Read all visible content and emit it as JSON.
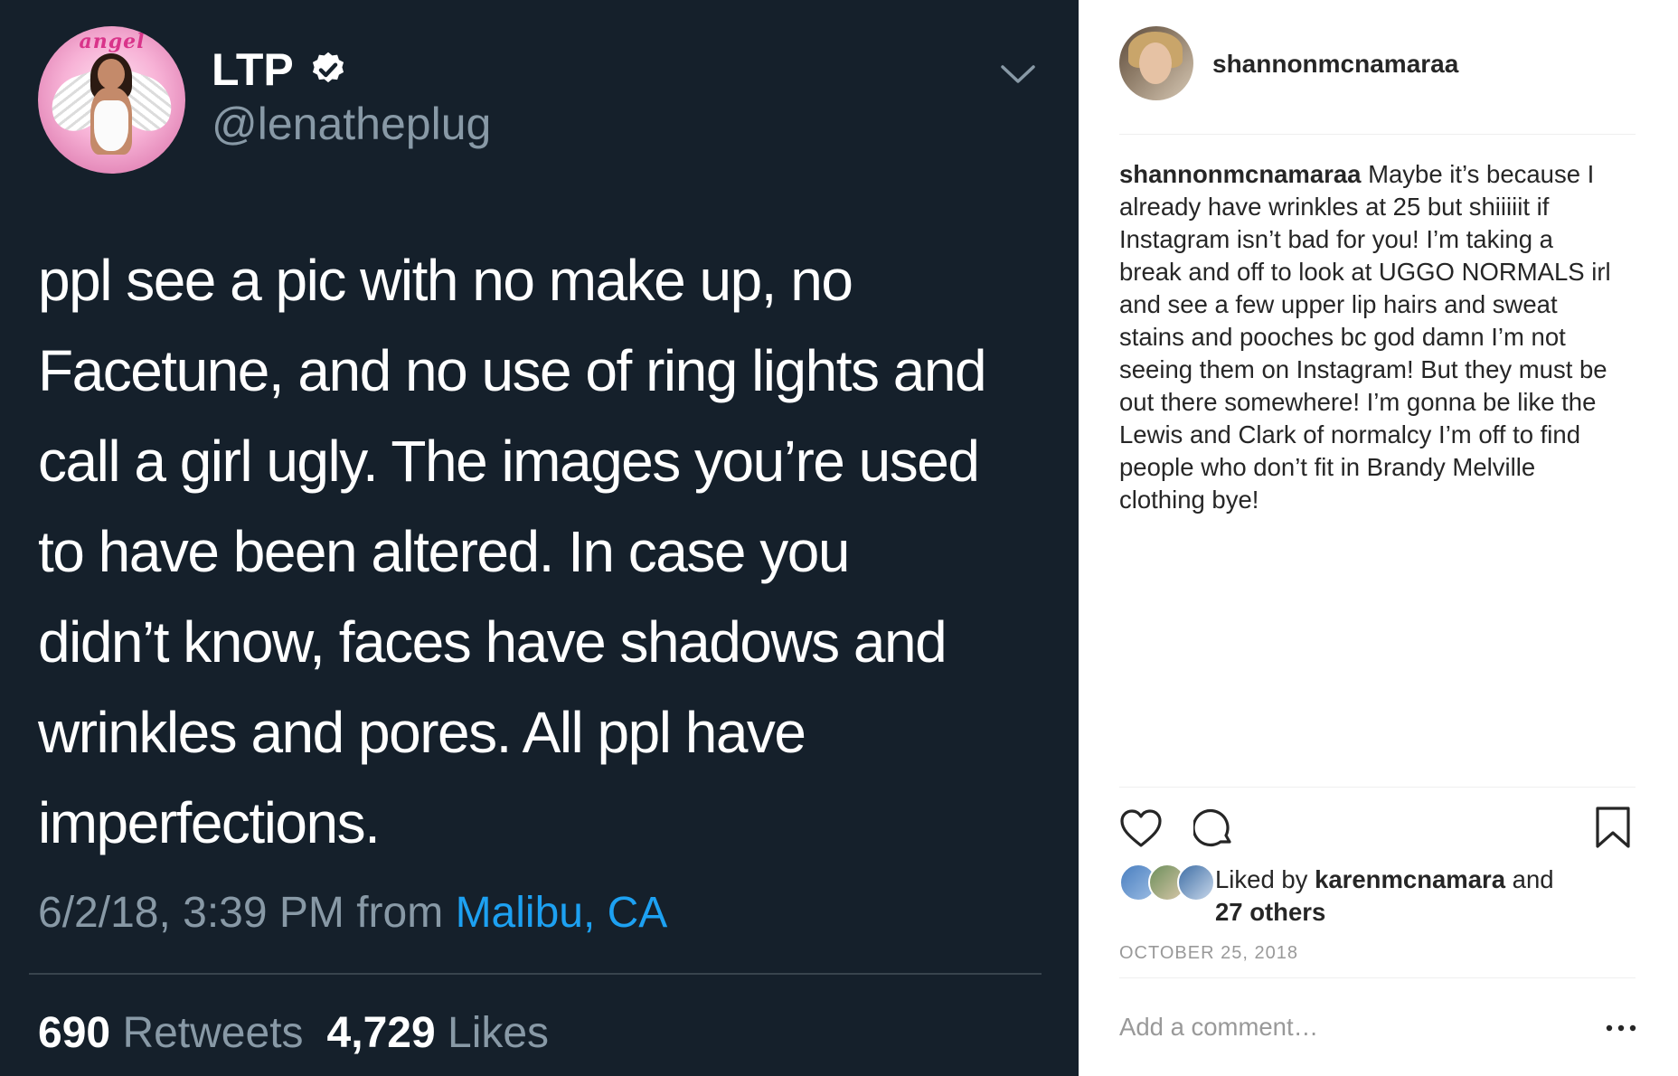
{
  "tweet": {
    "display_name": "LTP",
    "handle": "@lenatheplug",
    "avatar_text": "angel",
    "text_lines": [
      "ppl see a pic with no make up, no",
      "Facetune, and no use of ring lights and",
      "call a girl ugly. The images you’re used",
      "to have been altered. In case you",
      "didn’t know, faces have shadows and",
      "wrinkles and pores. All ppl have",
      "imperfections."
    ],
    "timestamp": "6/2/18, 3:39 PM from ",
    "location": "Malibu, CA",
    "retweets_count": "690",
    "retweets_label": "Retweets",
    "likes_count": "4,729",
    "likes_label": "Likes",
    "icons": {
      "verified": "verified-badge-icon",
      "menu": "chevron-down-icon"
    },
    "colors": {
      "background": "#15202b",
      "secondary_text": "#8899a6",
      "link": "#1da1f2"
    }
  },
  "instagram": {
    "username": "shannonmcnamaraa",
    "caption_username": "shannonmcnamaraa",
    "caption_lines": [
      " Maybe it’s because I",
      "already have wrinkles at 25 but shiiiiit if",
      "Instagram isn’t bad for you! I’m taking a",
      "break and off to look at UGGO NORMALS irl",
      "and see a few upper lip hairs and sweat",
      "stains and pooches bc god damn I’m not",
      "seeing them on Instagram! But they must be",
      "out there somewhere! I’m gonna be like the",
      "Lewis and Clark of normalcy I’m off to find",
      "people who don’t fit in Brandy Melville",
      "clothing bye!"
    ],
    "liked_by_prefix": "Liked by ",
    "liked_by_user": "karenmcnamara",
    "liked_by_suffix": " and",
    "liked_by_others": "27 others",
    "date": "OCTOBER 25, 2018",
    "comment_placeholder": "Add a comment…",
    "icons": {
      "like": "heart-icon",
      "comment": "comment-icon",
      "save": "bookmark-icon",
      "more": "more-icon"
    }
  }
}
